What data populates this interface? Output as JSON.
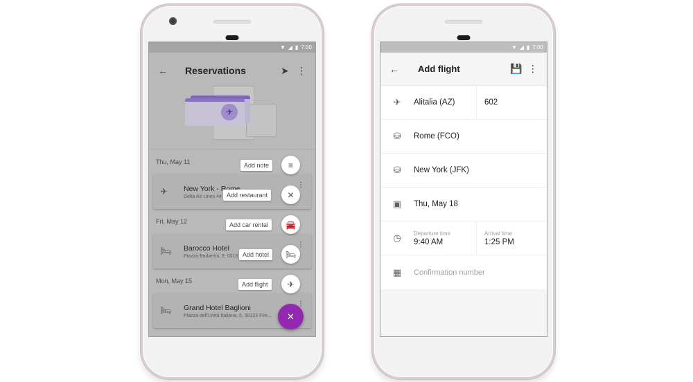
{
  "status_bar": {
    "time": "7:00",
    "icons": [
      "wifi-icon",
      "signal-icon",
      "battery-icon"
    ]
  },
  "left_screen": {
    "title": "Reservations",
    "actions": [
      "back-icon",
      "send-icon",
      "more-vert-icon"
    ],
    "sections": [
      {
        "date": "Thu, May 11",
        "item": {
          "icon": "flight-icon",
          "title": "New York - Rome",
          "subtitle": "Delta Air Lines 44"
        }
      },
      {
        "date": "Fri, May 12",
        "item": {
          "icon": "hotel-icon",
          "title": "Barocco Hotel",
          "subtitle": "Piazza Barberini, 9, 0018"
        }
      },
      {
        "date": "Mon, May 15",
        "item": {
          "icon": "hotel-icon",
          "title": "Grand Hotel Baglioni",
          "subtitle": "Piazza dell'Unità Italiana, 6, 50123 Fire..."
        }
      }
    ],
    "speed_dial": [
      {
        "label": "Add note",
        "icon": "notes-icon",
        "glyph": "≡"
      },
      {
        "label": "Add restaurant",
        "icon": "restaurant-icon",
        "glyph": "✕"
      },
      {
        "label": "Add car rental",
        "icon": "car-icon",
        "glyph": "🚘"
      },
      {
        "label": "Add hotel",
        "icon": "hotel-icon",
        "glyph": "🛏"
      },
      {
        "label": "Add flight",
        "icon": "flight-icon",
        "glyph": "✈"
      }
    ],
    "fab": {
      "icon": "close-icon",
      "glyph": "✕",
      "color": "#9427b0"
    }
  },
  "right_screen": {
    "title": "Add flight",
    "actions": [
      "back-icon",
      "save-icon",
      "more-vert-icon"
    ],
    "airline": "Alitalia (AZ)",
    "flight_number": "602",
    "departure_airport": "Rome (FCO)",
    "arrival_airport": "New York (JFK)",
    "date": "Thu, May 18",
    "departure_time_label": "Departure time",
    "departure_time": "9:40 AM",
    "arrival_time_label": "Arrival time",
    "arrival_time": "1:25 PM",
    "confirmation_placeholder": "Confirmation number"
  }
}
